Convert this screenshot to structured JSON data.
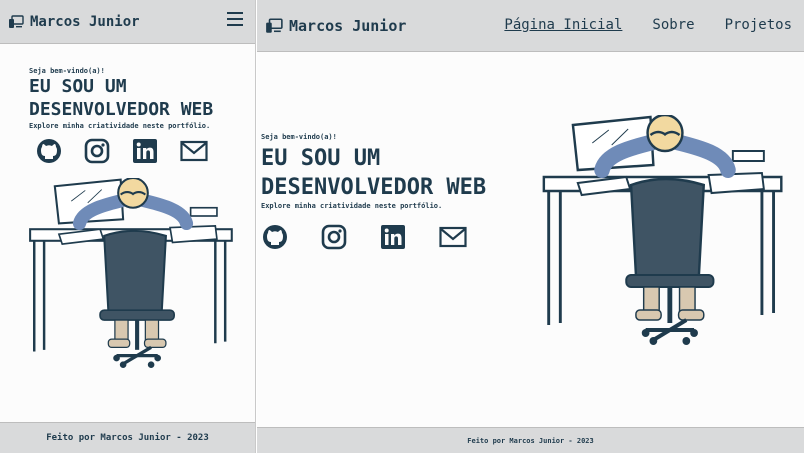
{
  "brand": {
    "name": "Marcos Junior",
    "icon": "devices-icon"
  },
  "nav": {
    "items": [
      {
        "label": "Página Inicial",
        "active": true
      },
      {
        "label": "Sobre",
        "active": false
      },
      {
        "label": "Projetos",
        "active": false
      }
    ],
    "menu_icon": "hamburger-menu-icon"
  },
  "hero": {
    "greeting": "Seja bem-vindo(a)!",
    "headline_line1": "EU SOU UM",
    "headline_line2": "DESENVOLVEDOR WEB",
    "subtitle": "Explore minha criatividade neste portfólio."
  },
  "socials": [
    "github-icon",
    "instagram-icon",
    "linkedin-icon",
    "email-icon"
  ],
  "footer": {
    "text": "Feito por Marcos Junior - 2023"
  },
  "colors": {
    "primary": "#1f3b4d",
    "chair": "#3f5464",
    "bar": "#d9dadb",
    "skin": "#f2d9a0",
    "shirt": "#6f8bb8"
  }
}
